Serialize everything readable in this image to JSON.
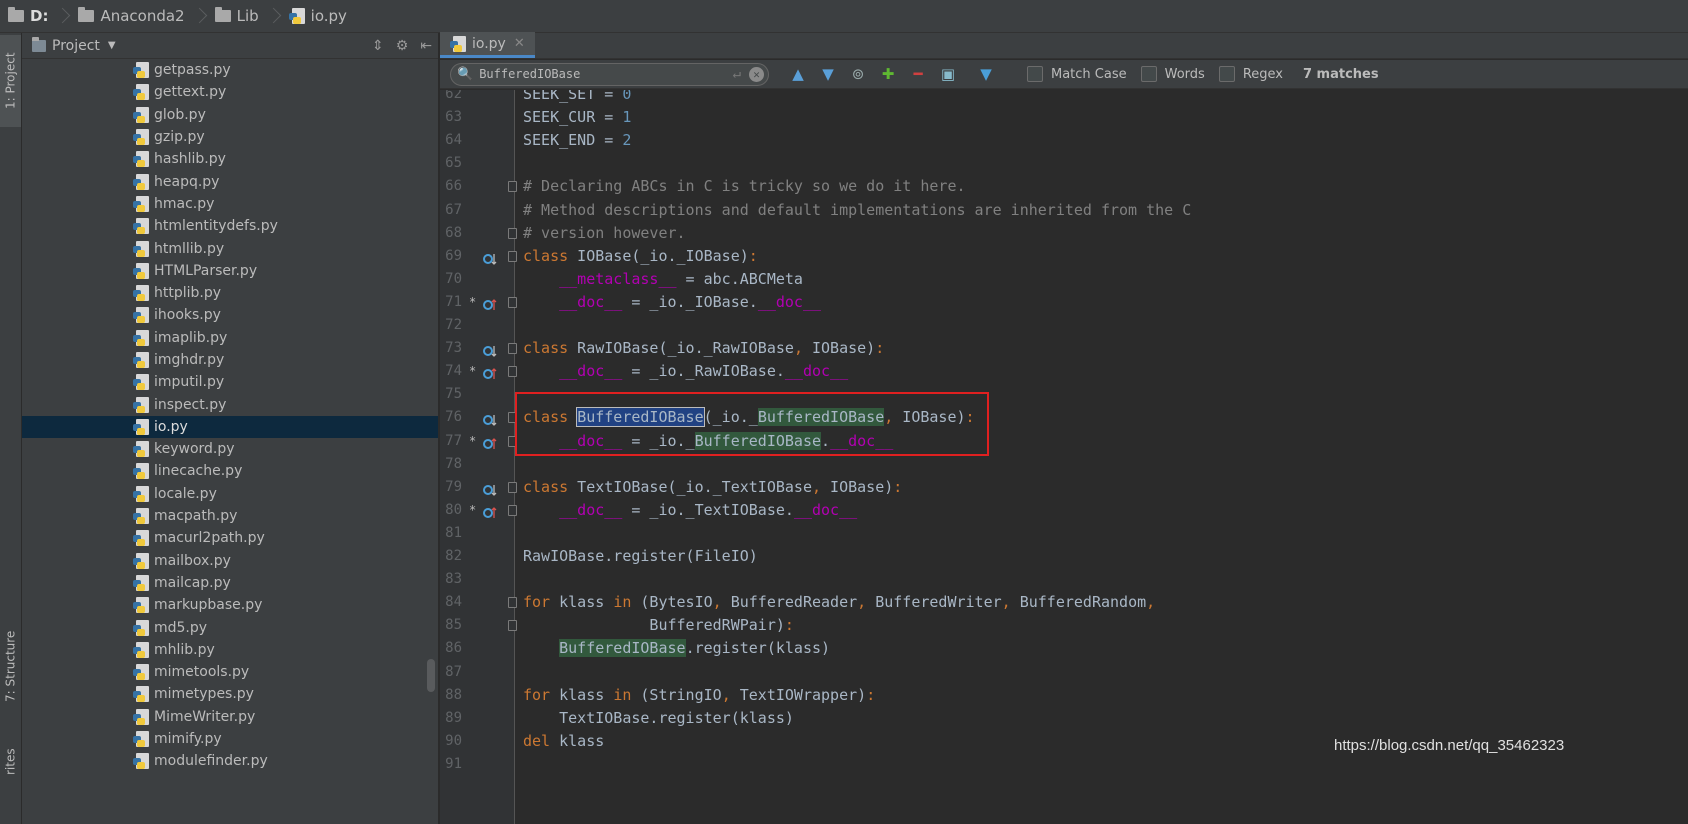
{
  "breadcrumb": [
    {
      "label": "D:",
      "icon": "folder-icon"
    },
    {
      "label": "Anaconda2",
      "icon": "folder-icon"
    },
    {
      "label": "Lib",
      "icon": "folder-icon"
    },
    {
      "label": "io.py",
      "icon": "python-file-icon"
    }
  ],
  "tool_strip": {
    "project_tab": "1: Project",
    "structure_tab": "7: Structure",
    "favorites_tab": "rites"
  },
  "project": {
    "title": "Project",
    "files": [
      "getpass.py",
      "gettext.py",
      "glob.py",
      "gzip.py",
      "hashlib.py",
      "heapq.py",
      "hmac.py",
      "htmlentitydefs.py",
      "htmllib.py",
      "HTMLParser.py",
      "httplib.py",
      "ihooks.py",
      "imaplib.py",
      "imghdr.py",
      "imputil.py",
      "inspect.py",
      "io.py",
      "keyword.py",
      "linecache.py",
      "locale.py",
      "macpath.py",
      "macurl2path.py",
      "mailbox.py",
      "mailcap.py",
      "markupbase.py",
      "md5.py",
      "mhlib.py",
      "mimetools.py",
      "mimetypes.py",
      "MimeWriter.py",
      "mimify.py",
      "modulefinder.py"
    ],
    "selected": "io.py"
  },
  "editor": {
    "tab": "io.py",
    "find": {
      "query": "BufferedIOBase",
      "match_case": "Match Case",
      "words": "Words",
      "regex": "Regex",
      "matches": "7 matches"
    },
    "lines": [
      {
        "n": "62",
        "text": "SEEK_SET = 0"
      },
      {
        "n": "63",
        "text": "SEEK_CUR = 1"
      },
      {
        "n": "64",
        "text": "SEEK_END = 2"
      },
      {
        "n": "65",
        "text": ""
      },
      {
        "n": "66",
        "text": "# Declaring ABCs in C is tricky so we do it here."
      },
      {
        "n": "67",
        "text": "# Method descriptions and default implementations are inherited from the C"
      },
      {
        "n": "68",
        "text": "# version however."
      },
      {
        "n": "69",
        "text": "class IOBase(_io._IOBase):"
      },
      {
        "n": "70",
        "text": "    __metaclass__ = abc.ABCMeta"
      },
      {
        "n": "71",
        "text": "    __doc__ = _io._IOBase.__doc__"
      },
      {
        "n": "72",
        "text": ""
      },
      {
        "n": "73",
        "text": "class RawIOBase(_io._RawIOBase, IOBase):"
      },
      {
        "n": "74",
        "text": "    __doc__ = _io._RawIOBase.__doc__"
      },
      {
        "n": "75",
        "text": ""
      },
      {
        "n": "76",
        "text": "class BufferedIOBase(_io._BufferedIOBase, IOBase):"
      },
      {
        "n": "77",
        "text": "    __doc__ = _io._BufferedIOBase.__doc__"
      },
      {
        "n": "78",
        "text": ""
      },
      {
        "n": "79",
        "text": "class TextIOBase(_io._TextIOBase, IOBase):"
      },
      {
        "n": "80",
        "text": "    __doc__ = _io._TextIOBase.__doc__"
      },
      {
        "n": "81",
        "text": ""
      },
      {
        "n": "82",
        "text": "RawIOBase.register(FileIO)"
      },
      {
        "n": "83",
        "text": ""
      },
      {
        "n": "84",
        "text": "for klass in (BytesIO, BufferedReader, BufferedWriter, BufferedRandom,"
      },
      {
        "n": "85",
        "text": "              BufferedRWPair):"
      },
      {
        "n": "86",
        "text": "    BufferedIOBase.register(klass)"
      },
      {
        "n": "87",
        "text": ""
      },
      {
        "n": "88",
        "text": "for klass in (StringIO, TextIOWrapper):"
      },
      {
        "n": "89",
        "text": "    TextIOBase.register(klass)"
      },
      {
        "n": "90",
        "text": "del klass"
      },
      {
        "n": "91",
        "text": ""
      }
    ]
  },
  "watermark": "https://blog.csdn.net/qq_35462323"
}
